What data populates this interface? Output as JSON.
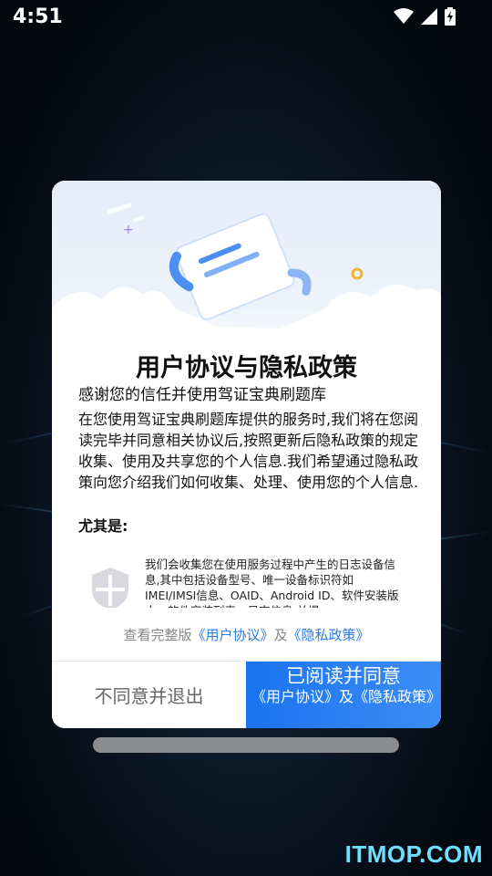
{
  "status_bar": {
    "time": "4:51",
    "icons": [
      "wifi-icon",
      "cell-signal-icon",
      "battery-charging-icon"
    ]
  },
  "dialog": {
    "title": "用户协议与隐私政策",
    "intro": "感谢您的信任并使用驾证宝典刷题库",
    "body": "在您使用驾证宝典刷题库提供的服务时,我们将在您阅读完毕并同意相关协议后,按照更新后隐私政策的规定收集、使用及共享您的个人信息.我们希望通过隐私政策向您介绍我们如何收集、处理、使用您的个人信息.",
    "emphasis": "尤其是:",
    "item_icon": "shield-icon",
    "item_text": "我们会收集您在使用服务过程中产生的日志设备信息,其中包括设备型号、唯一设备标识符如IMEI/IMSI信息、OAID、Android ID、软件安装版本、软件安装列表、日志信息,并提",
    "links": {
      "prefix": "查看完整版",
      "user_agreement": "《用户协议》",
      "and": "及",
      "privacy_policy": "《隐私政策》"
    },
    "buttons": {
      "disagree": "不同意并退出",
      "agree_main": "已阅读并同意",
      "agree_sub": "《用户协议》及《隐私政策》"
    }
  },
  "watermark": "ITMOP.COM",
  "colors": {
    "accent": "#1a73f0",
    "link": "#2a7de1",
    "background": "#050a12"
  }
}
